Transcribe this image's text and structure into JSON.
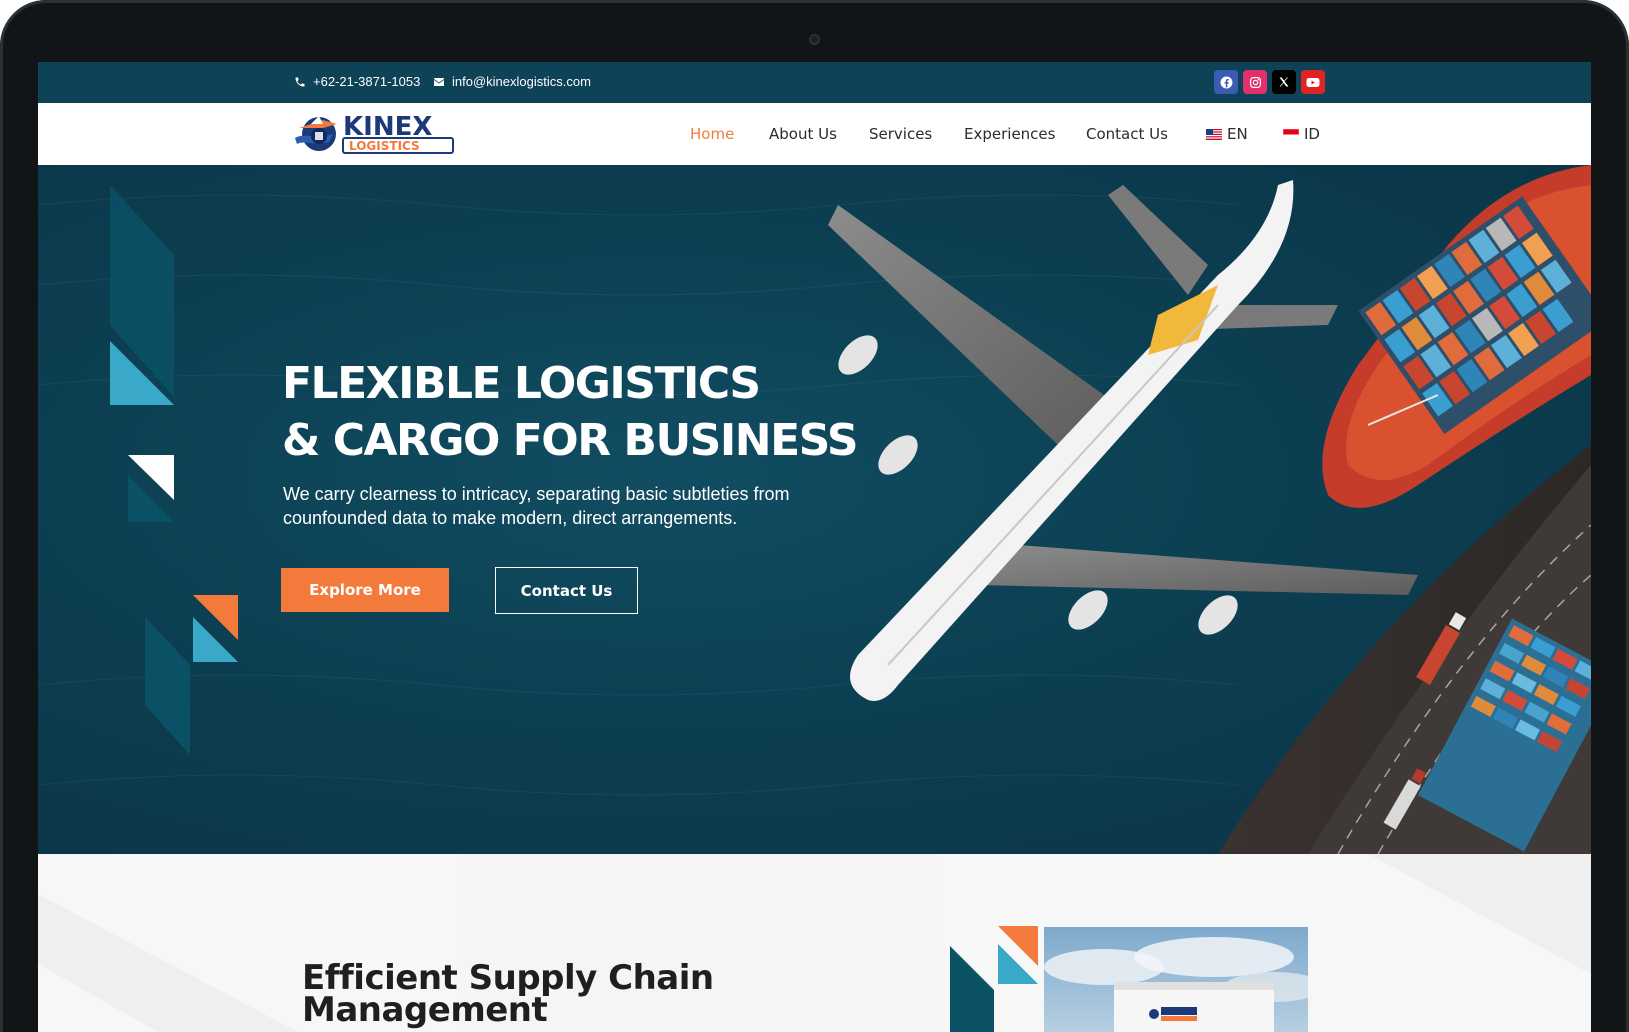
{
  "topbar": {
    "phone": "+62-21-3871-1053",
    "email": "info@kinexlogistics.com",
    "socials": [
      {
        "name": "facebook",
        "color": "#3b5bb5"
      },
      {
        "name": "instagram",
        "color": "#e1306c"
      },
      {
        "name": "x",
        "color": "#000000"
      },
      {
        "name": "youtube",
        "color": "#e02424"
      }
    ]
  },
  "nav": {
    "logo_text": "KINEX",
    "logo_sub": "LOGISTICS",
    "items": [
      {
        "label": "Home",
        "active": true
      },
      {
        "label": "About Us",
        "active": false
      },
      {
        "label": "Services",
        "active": false
      },
      {
        "label": "Experiences",
        "active": false
      },
      {
        "label": "Contact Us",
        "active": false
      }
    ],
    "languages": [
      {
        "code": "EN",
        "flag": "us-flag-icon"
      },
      {
        "code": "ID",
        "flag": "id-flag-icon"
      }
    ]
  },
  "hero": {
    "title_line1": "FLEXIBLE LOGISTICS",
    "title_line2": "& CARGO FOR BUSINESS",
    "subtitle": "We carry clearness to intricacy, separating basic subtleties from counfounded data to make modern, direct arrangements.",
    "primary_button": "Explore More",
    "secondary_button": "Contact Us"
  },
  "section": {
    "title": "Efficient Supply Chain Management"
  },
  "colors": {
    "primary": "#0e4257",
    "accent": "#f47a3b",
    "light_blue": "#3aa8c8"
  }
}
